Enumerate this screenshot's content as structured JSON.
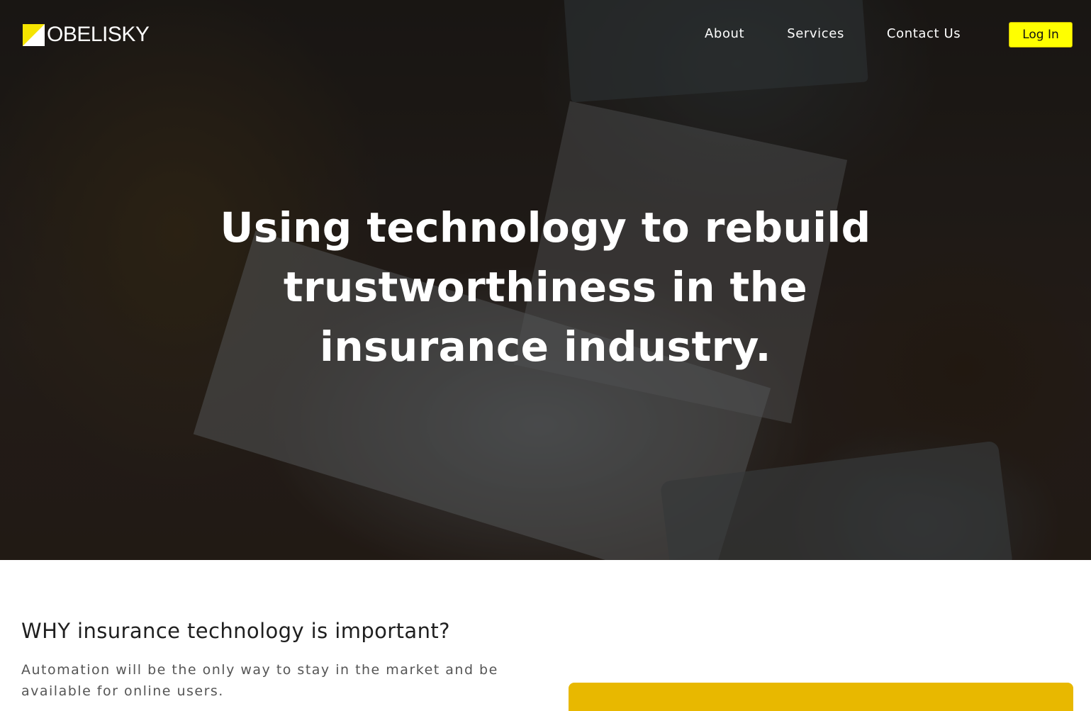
{
  "brand": {
    "name": "OBELISKY",
    "logo_icon": "obelisk-triangle-icon",
    "accent_color": "#ffff00"
  },
  "nav": {
    "links": [
      {
        "label": "About"
      },
      {
        "label": "Services"
      },
      {
        "label": "Contact Us"
      }
    ],
    "login_label": "Log In"
  },
  "hero": {
    "title": "Using technology to rebuild trustworthiness in the insurance industry."
  },
  "why": {
    "title": "WHY insurance technology is important?",
    "text": "Automation will be the only way to stay in the market and be available for online users.",
    "card_color": "#e8b800"
  }
}
